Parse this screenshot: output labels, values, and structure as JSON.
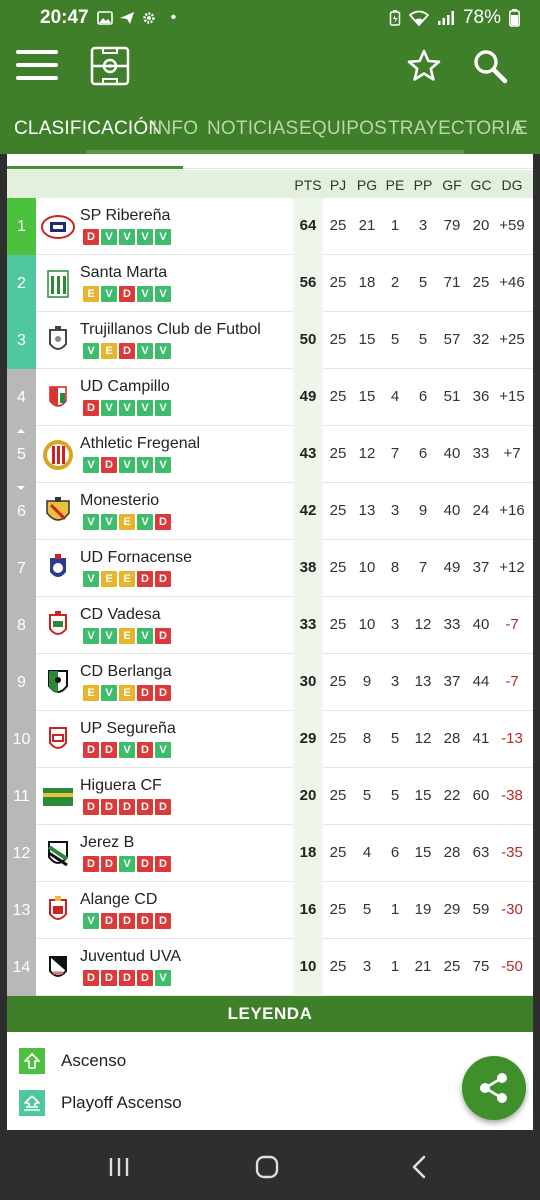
{
  "status": {
    "time": "20:47",
    "dot": "•",
    "battery": "78%"
  },
  "tabs": [
    {
      "label": "CLASIFICACIÓN",
      "active": true
    },
    {
      "label": "INFO"
    },
    {
      "label": "NOTICIAS"
    },
    {
      "label": "EQUIPOS"
    },
    {
      "label": "TRAYECTORIA"
    },
    {
      "label": "E"
    }
  ],
  "columns": [
    "PTS",
    "PJ",
    "PG",
    "PE",
    "PP",
    "GF",
    "GC",
    "DG"
  ],
  "rows": [
    {
      "pos": "1",
      "zone": "up",
      "trend": "",
      "team": "SP Ribereña",
      "form": [
        "D",
        "V",
        "V",
        "V",
        "V"
      ],
      "pts": "64",
      "pj": "25",
      "pg": "21",
      "pe": "1",
      "pp": "3",
      "gf": "79",
      "gc": "20",
      "dg": "+59"
    },
    {
      "pos": "2",
      "zone": "playoff",
      "trend": "",
      "team": "Santa Marta",
      "form": [
        "E",
        "V",
        "D",
        "V",
        "V"
      ],
      "pts": "56",
      "pj": "25",
      "pg": "18",
      "pe": "2",
      "pp": "5",
      "gf": "71",
      "gc": "25",
      "dg": "+46"
    },
    {
      "pos": "3",
      "zone": "playoff",
      "trend": "",
      "team": "Trujillanos Club de Futbol",
      "form": [
        "V",
        "E",
        "D",
        "V",
        "V"
      ],
      "pts": "50",
      "pj": "25",
      "pg": "15",
      "pe": "5",
      "pp": "5",
      "gf": "57",
      "gc": "32",
      "dg": "+25"
    },
    {
      "pos": "4",
      "zone": "none",
      "trend": "",
      "team": "UD Campillo",
      "form": [
        "D",
        "V",
        "V",
        "V",
        "V"
      ],
      "pts": "49",
      "pj": "25",
      "pg": "15",
      "pe": "4",
      "pp": "6",
      "gf": "51",
      "gc": "36",
      "dg": "+15"
    },
    {
      "pos": "5",
      "zone": "none",
      "trend": "up",
      "team": "Athletic Fregenal",
      "form": [
        "V",
        "D",
        "V",
        "V",
        "V"
      ],
      "pts": "43",
      "pj": "25",
      "pg": "12",
      "pe": "7",
      "pp": "6",
      "gf": "40",
      "gc": "33",
      "dg": "+7"
    },
    {
      "pos": "6",
      "zone": "none",
      "trend": "down",
      "team": "Monesterio",
      "form": [
        "V",
        "V",
        "E",
        "V",
        "D"
      ],
      "pts": "42",
      "pj": "25",
      "pg": "13",
      "pe": "3",
      "pp": "9",
      "gf": "40",
      "gc": "24",
      "dg": "+16"
    },
    {
      "pos": "7",
      "zone": "none",
      "trend": "",
      "team": "UD Fornacense",
      "form": [
        "V",
        "E",
        "E",
        "D",
        "D"
      ],
      "pts": "38",
      "pj": "25",
      "pg": "10",
      "pe": "8",
      "pp": "7",
      "gf": "49",
      "gc": "37",
      "dg": "+12"
    },
    {
      "pos": "8",
      "zone": "none",
      "trend": "",
      "team": "CD Vadesa",
      "form": [
        "V",
        "V",
        "E",
        "V",
        "D"
      ],
      "pts": "33",
      "pj": "25",
      "pg": "10",
      "pe": "3",
      "pp": "12",
      "gf": "33",
      "gc": "40",
      "dg": "-7"
    },
    {
      "pos": "9",
      "zone": "none",
      "trend": "",
      "team": "CD Berlanga",
      "form": [
        "E",
        "V",
        "E",
        "D",
        "D"
      ],
      "pts": "30",
      "pj": "25",
      "pg": "9",
      "pe": "3",
      "pp": "13",
      "gf": "37",
      "gc": "44",
      "dg": "-7"
    },
    {
      "pos": "10",
      "zone": "none",
      "trend": "",
      "team": "UP Segureña",
      "form": [
        "D",
        "D",
        "V",
        "D",
        "V"
      ],
      "pts": "29",
      "pj": "25",
      "pg": "8",
      "pe": "5",
      "pp": "12",
      "gf": "28",
      "gc": "41",
      "dg": "-13"
    },
    {
      "pos": "11",
      "zone": "none",
      "trend": "",
      "team": "Higuera CF",
      "form": [
        "D",
        "D",
        "D",
        "D",
        "D"
      ],
      "pts": "20",
      "pj": "25",
      "pg": "5",
      "pe": "5",
      "pp": "15",
      "gf": "22",
      "gc": "60",
      "dg": "-38"
    },
    {
      "pos": "12",
      "zone": "none",
      "trend": "",
      "team": "Jerez B",
      "form": [
        "D",
        "D",
        "V",
        "D",
        "D"
      ],
      "pts": "18",
      "pj": "25",
      "pg": "4",
      "pe": "6",
      "pp": "15",
      "gf": "28",
      "gc": "63",
      "dg": "-35"
    },
    {
      "pos": "13",
      "zone": "none",
      "trend": "",
      "team": "Alange CD",
      "form": [
        "V",
        "D",
        "D",
        "D",
        "D"
      ],
      "pts": "16",
      "pj": "25",
      "pg": "5",
      "pe": "1",
      "pp": "19",
      "gf": "29",
      "gc": "59",
      "dg": "-30"
    },
    {
      "pos": "14",
      "zone": "none",
      "trend": "",
      "team": "Juventud UVA",
      "form": [
        "D",
        "D",
        "D",
        "D",
        "V"
      ],
      "pts": "10",
      "pj": "25",
      "pg": "3",
      "pe": "1",
      "pp": "21",
      "gf": "25",
      "gc": "75",
      "dg": "-50"
    }
  ],
  "legend": {
    "title": "LEYENDA",
    "items": [
      {
        "label": "Ascenso",
        "icon": "arrow-up-icon",
        "color": "#4cc13d"
      },
      {
        "label": "Playoff Ascenso",
        "icon": "playoff-icon",
        "color": "#4fc8a0"
      }
    ]
  },
  "colors": {
    "brand_green": "#3f7f2a",
    "win": "#3dbd6c",
    "draw": "#e7b52b",
    "loss": "#dc3a3a",
    "negative": "#b02b2b"
  }
}
